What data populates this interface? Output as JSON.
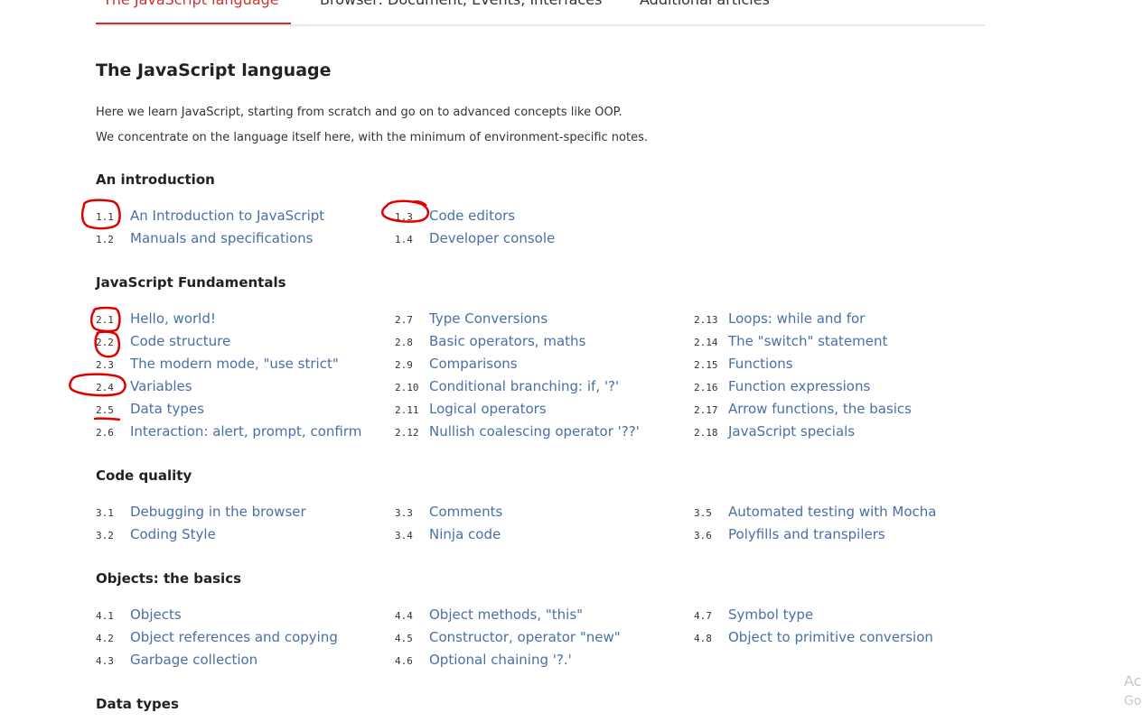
{
  "tabs": [
    {
      "label": "The JavaScript language",
      "active": true
    },
    {
      "label": "Browser: Document, Events, Interfaces"
    },
    {
      "label": "Additional articles"
    }
  ],
  "title": "The JavaScript language",
  "intro": [
    "Here we learn JavaScript, starting from scratch and go on to advanced concepts like OOP.",
    "We concentrate on the language itself here, with the minimum of environment-specific notes."
  ],
  "sections": [
    {
      "title": "An introduction",
      "items": [
        {
          "num": "1.1",
          "label": "An Introduction to JavaScript"
        },
        {
          "num": "1.2",
          "label": "Manuals and specifications"
        },
        {
          "num": "1.3",
          "label": "Code editors"
        },
        {
          "num": "1.4",
          "label": "Developer console"
        }
      ]
    },
    {
      "title": "JavaScript Fundamentals",
      "items": [
        {
          "num": "2.1",
          "label": "Hello, world!"
        },
        {
          "num": "2.2",
          "label": "Code structure"
        },
        {
          "num": "2.3",
          "label": "The modern mode, \"use strict\""
        },
        {
          "num": "2.4",
          "label": "Variables"
        },
        {
          "num": "2.5",
          "label": "Data types"
        },
        {
          "num": "2.6",
          "label": "Interaction: alert, prompt, confirm"
        },
        {
          "num": "2.7",
          "label": "Type Conversions"
        },
        {
          "num": "2.8",
          "label": "Basic operators, maths"
        },
        {
          "num": "2.9",
          "label": "Comparisons"
        },
        {
          "num": "2.10",
          "label": "Conditional branching: if, '?'"
        },
        {
          "num": "2.11",
          "label": "Logical operators"
        },
        {
          "num": "2.12",
          "label": "Nullish coalescing operator '??'"
        },
        {
          "num": "2.13",
          "label": "Loops: while and for"
        },
        {
          "num": "2.14",
          "label": "The \"switch\" statement"
        },
        {
          "num": "2.15",
          "label": "Functions"
        },
        {
          "num": "2.16",
          "label": "Function expressions"
        },
        {
          "num": "2.17",
          "label": "Arrow functions, the basics"
        },
        {
          "num": "2.18",
          "label": "JavaScript specials"
        }
      ]
    },
    {
      "title": "Code quality",
      "items": [
        {
          "num": "3.1",
          "label": "Debugging in the browser"
        },
        {
          "num": "3.2",
          "label": "Coding Style"
        },
        {
          "num": "3.3",
          "label": "Comments"
        },
        {
          "num": "3.4",
          "label": "Ninja code"
        },
        {
          "num": "3.5",
          "label": "Automated testing with Mocha"
        },
        {
          "num": "3.6",
          "label": "Polyfills and transpilers"
        }
      ]
    },
    {
      "title": "Objects: the basics",
      "items": [
        {
          "num": "4.1",
          "label": "Objects"
        },
        {
          "num": "4.2",
          "label": "Object references and copying"
        },
        {
          "num": "4.3",
          "label": "Garbage collection"
        },
        {
          "num": "4.4",
          "label": "Object methods, \"this\""
        },
        {
          "num": "4.5",
          "label": "Constructor, operator \"new\""
        },
        {
          "num": "4.6",
          "label": "Optional chaining '?.'"
        },
        {
          "num": "4.7",
          "label": "Symbol type"
        },
        {
          "num": "4.8",
          "label": "Object to primitive conversion"
        }
      ]
    },
    {
      "title": "Data types",
      "items": []
    }
  ],
  "watermark": [
    "Ac",
    "Go"
  ],
  "colors": {
    "link": "#4a6fa5",
    "accent": "#cc3333",
    "annotation": "#e00000"
  }
}
